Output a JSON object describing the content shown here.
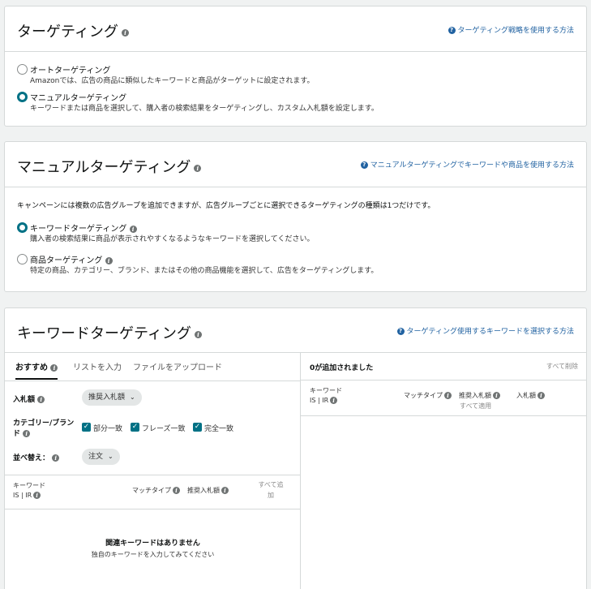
{
  "targeting": {
    "title": "ターゲティング",
    "help_link": "ターゲティング戦略を使用する方法",
    "options": [
      {
        "label": "オートターゲティング",
        "desc": "Amazonでは、広告の商品に類似したキーワードと商品がターゲットに設定されます。",
        "selected": false
      },
      {
        "label": "マニュアルターゲティング",
        "desc": "キーワードまたは商品を選択して、購入者の検索結果をターゲティングし、カスタム入札額を設定します。",
        "selected": true
      }
    ]
  },
  "manual_targeting": {
    "title": "マニュアルターゲティング",
    "help_link": "マニュアルターゲティングでキーワードや商品を使用する方法",
    "description": "キャンペーンには複数の広告グループを追加できますが、広告グループごとに選択できるターゲティングの種類は1つだけです。",
    "options": [
      {
        "label": "キーワードターゲティング",
        "desc": "購入者の検索結果に商品が表示されやすくなるようなキーワードを選択してください。",
        "selected": true
      },
      {
        "label": "商品ターゲティング",
        "desc": "特定の商品、カテゴリー、ブランド、またはその他の商品機能を選択して、広告をターゲティングします。",
        "selected": false
      }
    ]
  },
  "keyword_targeting": {
    "title": "キーワードターゲティング",
    "help_link": "ターゲティング使用するキーワードを選択する方法",
    "tabs": [
      "おすすめ",
      "リストを入力",
      "ファイルをアップロード"
    ],
    "filters": {
      "bid_label": "入札額",
      "bid_value": "推奨入札額",
      "category_label_1": "カテゴリー/ブラン",
      "category_label_2": "ド",
      "match_types": [
        "部分一致",
        "フレーズ一致",
        "完全一致"
      ],
      "sort_label": "並べ替え：",
      "sort_value": "注文"
    },
    "left_table": {
      "col_keyword": "キーワード",
      "col_is_ir": "IS | IR",
      "col_match": "マッチタイプ",
      "col_bid": "推奨入札額",
      "add_all_1": "すべて追",
      "add_all_2": "加",
      "empty_title": "関連キーワードはありません",
      "empty_sub": "独自のキーワードを入力してみてください"
    },
    "right_panel": {
      "added_count": "0が追加されました",
      "remove_all": "すべて削除",
      "col_keyword": "キーワード",
      "col_is_ir": "IS | IR",
      "col_match": "マッチタイプ",
      "col_suggested": "推奨入札額",
      "apply_all": "すべて適用",
      "col_bid": "入札額"
    }
  }
}
